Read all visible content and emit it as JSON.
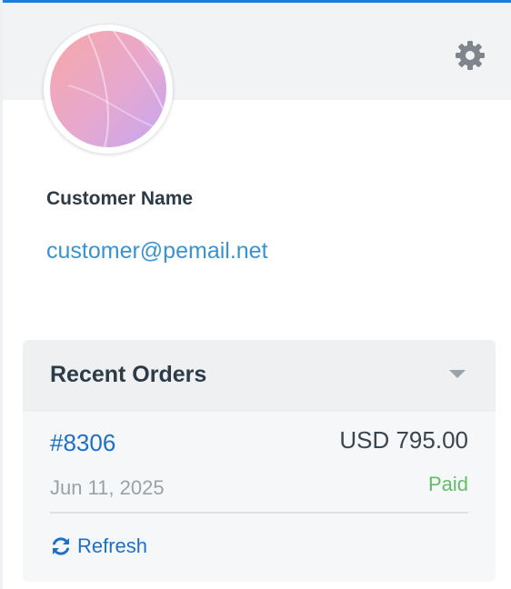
{
  "customer": {
    "name": "Customer Name",
    "email": "customer@pemail.net"
  },
  "icons": {
    "settings": "gear-icon",
    "collapse": "caret-down-icon",
    "refresh": "refresh-icon"
  },
  "orders": {
    "title": "Recent Orders",
    "items": [
      {
        "number": "#8306",
        "amount": "USD 795.00",
        "date": "Jun 11, 2025",
        "status": "Paid"
      }
    ],
    "refresh_label": "Refresh"
  },
  "colors": {
    "accent": "#1e7ed6",
    "link": "#1e6fc7",
    "email": "#3a93d0",
    "paid": "#66bb6a"
  }
}
